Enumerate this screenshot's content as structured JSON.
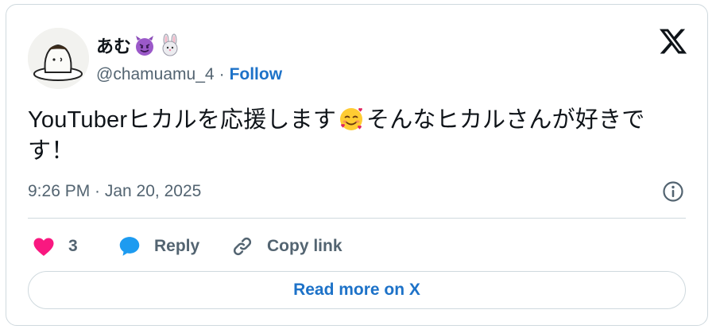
{
  "author": {
    "display_name": "あむ",
    "name_emojis": [
      "smiling-imp-emoji",
      "rabbit-emoji"
    ],
    "handle": "@chamuamu_4",
    "separator": "·",
    "follow_label": "Follow"
  },
  "tweet": {
    "text_part1": "YouTuberヒカルを応援します",
    "inline_emoji": "smiling-face-with-hearts-emoji",
    "text_part2": "そんなヒカルさんが好きです！",
    "timestamp": "9:26 PM · Jan 20, 2025"
  },
  "actions": {
    "like_count": "3",
    "reply_label": "Reply",
    "copy_link_label": "Copy link",
    "read_more_label": "Read more on X"
  },
  "colors": {
    "accent_blue": "#1d72c8",
    "like_pink": "#f91880",
    "reply_blue": "#1d9bf0",
    "text_primary": "#0f1419",
    "text_secondary": "#536471",
    "border": "#cfd9de"
  },
  "icons": {
    "brand": "x-logo-icon",
    "info": "info-icon",
    "like": "heart-icon",
    "reply": "speech-bubble-icon",
    "copy": "link-icon"
  }
}
